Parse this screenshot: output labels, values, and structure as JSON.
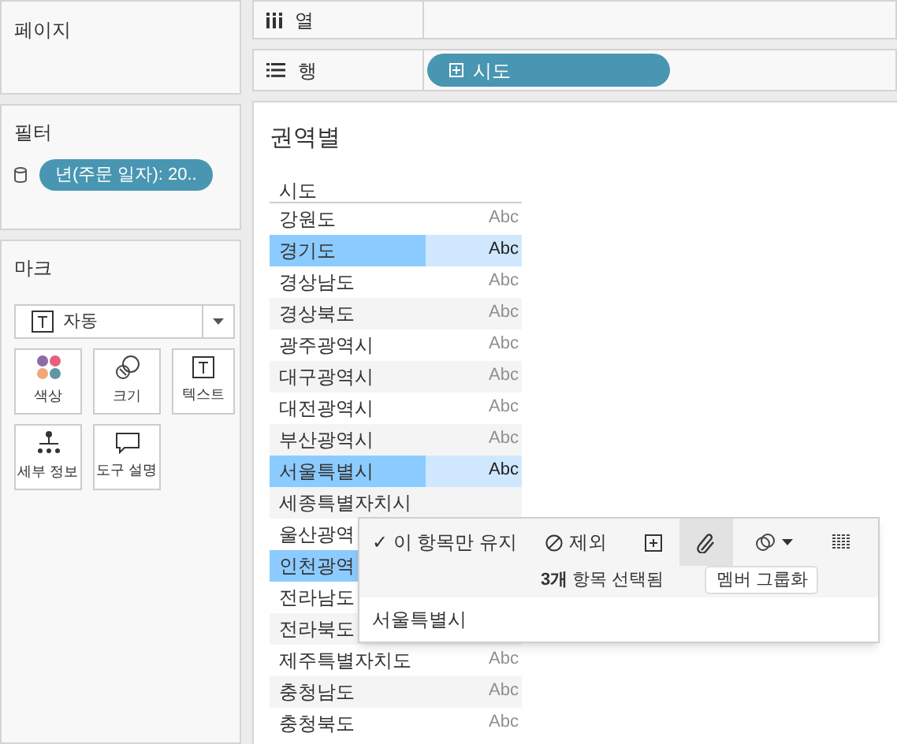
{
  "pages_panel": {
    "title": "페이지"
  },
  "columns_shelf": {
    "label": "열"
  },
  "rows_shelf": {
    "label": "행",
    "pill": "시도"
  },
  "filters_panel": {
    "title": "필터",
    "pill": "년(주문 일자): 20.."
  },
  "marks_panel": {
    "title": "마크",
    "mark_type": "자동",
    "cards": [
      {
        "kind": "color",
        "label": "색상"
      },
      {
        "kind": "size",
        "label": "크기"
      },
      {
        "kind": "text",
        "label": "텍스트"
      },
      {
        "kind": "detail",
        "label": "세부 정보"
      },
      {
        "kind": "tooltip",
        "label": "도구 설명"
      }
    ]
  },
  "view": {
    "title": "권역별",
    "column_header": "시도",
    "rows": [
      {
        "label": "강원도",
        "abc": "Abc",
        "selected": false
      },
      {
        "label": "경기도",
        "abc": "Abc",
        "selected": true
      },
      {
        "label": "경상남도",
        "abc": "Abc",
        "selected": false
      },
      {
        "label": "경상북도",
        "abc": "Abc",
        "selected": false
      },
      {
        "label": "광주광역시",
        "abc": "Abc",
        "selected": false
      },
      {
        "label": "대구광역시",
        "abc": "Abc",
        "selected": false
      },
      {
        "label": "대전광역시",
        "abc": "Abc",
        "selected": false
      },
      {
        "label": "부산광역시",
        "abc": "Abc",
        "selected": false
      },
      {
        "label": "서울특별시",
        "abc": "Abc",
        "selected": true
      },
      {
        "label": "세종특별자치시",
        "selected": false
      },
      {
        "label": "울산광역",
        "selected": false
      },
      {
        "label": "인천광역",
        "selected": true
      },
      {
        "label": "전라남도",
        "selected": false
      },
      {
        "label": "전라북도",
        "selected": false
      },
      {
        "label": "제주특별자치도",
        "abc": "Abc",
        "selected": false
      },
      {
        "label": "충청남도",
        "abc": "Abc",
        "selected": false
      },
      {
        "label": "충청북도",
        "abc": "Abc",
        "selected": false
      }
    ]
  },
  "tooltip": {
    "keep_only": "✓ 이 항목만 유지",
    "exclude": "제외",
    "tools": [
      {
        "kind": "plus",
        "selected": false
      },
      {
        "kind": "clip",
        "selected": true
      },
      {
        "kind": "link",
        "selected": false
      },
      {
        "kind": "grid",
        "selected": false
      }
    ],
    "selection_count": "**3개** 항목 선택됨",
    "group_button": "멤버 그룹화",
    "item": "서울특별시"
  }
}
